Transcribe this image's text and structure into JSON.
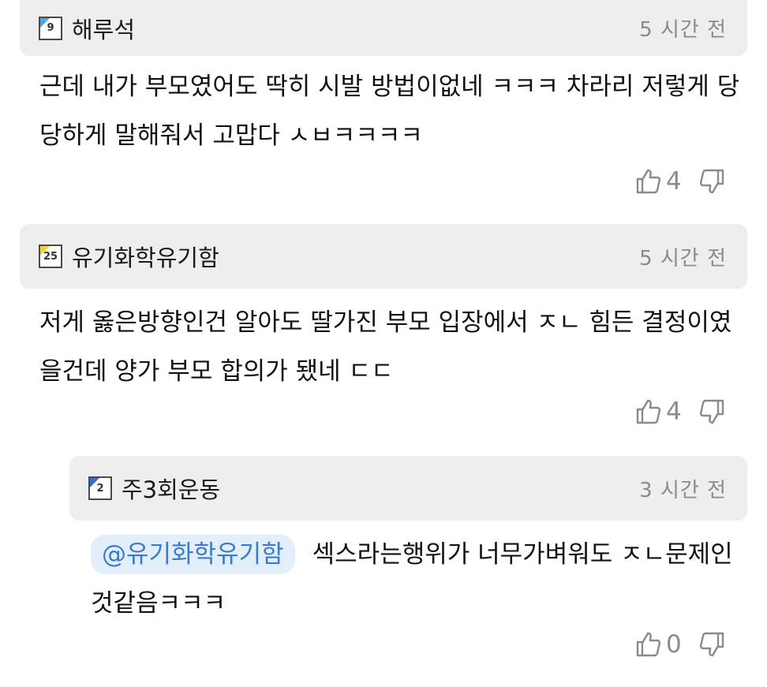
{
  "comments": [
    {
      "level": "9",
      "level_color": "#4aa8e8",
      "user": "해루석",
      "time": "5 시간 전",
      "text": "근데 내가 부모였어도 딱히 시발 방법이없네 ㅋㅋㅋ 차라리 저렇게 당당하게 말해줘서 고맙다 ㅅㅂㅋㅋㅋㅋ",
      "likes": "4"
    },
    {
      "level": "25",
      "level_color": "#f2d43a",
      "user": "유기화학유기함",
      "time": "5 시간 전",
      "text": "저게 옳은방향인건 알아도 딸가진 부모 입장에서 ㅈㄴ 힘든 결정이였을건데 양가 부모 합의가 됐네 ㄷㄷ",
      "likes": "4"
    },
    {
      "level": "2",
      "level_color": "#3a6fc4",
      "user": "주3회운동",
      "time": "3 시간 전",
      "mention": "@유기화학유기함",
      "text": "섹스라는행위가 너무가벼워도 ㅈㄴ문제인것같음ㅋㅋㅋ",
      "likes": "0"
    }
  ],
  "icons": {
    "like": "thumbs-up-icon",
    "dislike": "thumbs-down-icon"
  }
}
